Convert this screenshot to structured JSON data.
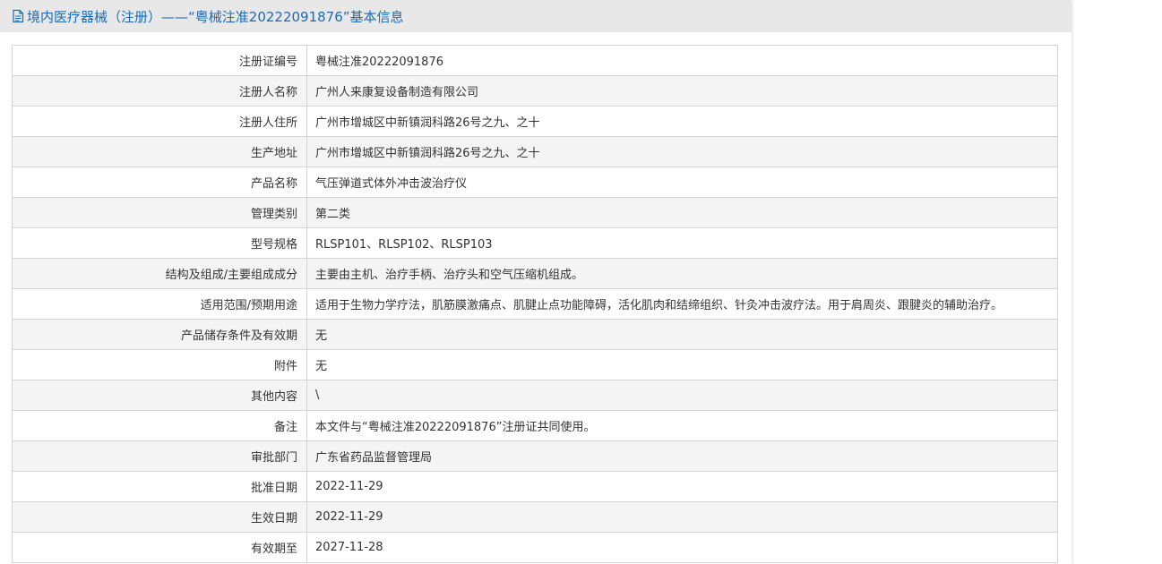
{
  "header": {
    "title": "境内医疗器械（注册）——“粤械注准20222091876”基本信息",
    "icon": "document-icon",
    "color": "#1a6bb5"
  },
  "table": {
    "rows": [
      {
        "label": "注册证编号",
        "value": "粤械注准20222091876"
      },
      {
        "label": "注册人名称",
        "value": "广州人来康复设备制造有限公司"
      },
      {
        "label": "注册人住所",
        "value": "广州市增城区中新镇润科路26号之九、之十"
      },
      {
        "label": "生产地址",
        "value": "广州市增城区中新镇润科路26号之九、之十"
      },
      {
        "label": "产品名称",
        "value": "气压弹道式体外冲击波治疗仪"
      },
      {
        "label": "管理类别",
        "value": "第二类"
      },
      {
        "label": "型号规格",
        "value": "RLSP101、RLSP102、RLSP103"
      },
      {
        "label": "结构及组成/主要组成成分",
        "value": "主要由主机、治疗手柄、治疗头和空气压缩机组成。"
      },
      {
        "label": "适用范围/预期用途",
        "value": "适用于生物力学疗法，肌筋膜激痛点、肌腱止点功能障碍，活化肌肉和结缔组织、针灸冲击波疗法。用于肩周炎、跟腱炎的辅助治疗。"
      },
      {
        "label": "产品储存条件及有效期",
        "value": "无"
      },
      {
        "label": "附件",
        "value": "无"
      },
      {
        "label": "其他内容",
        "value": "\\"
      },
      {
        "label": "备注",
        "value": "本文件与“粤械注准20222091876”注册证共同使用。"
      },
      {
        "label": "审批部门",
        "value": "广东省药品监督管理局"
      },
      {
        "label": "批准日期",
        "value": "2022-11-29"
      },
      {
        "label": "生效日期",
        "value": "2022-11-29"
      },
      {
        "label": "有效期至",
        "value": "2027-11-28"
      }
    ]
  }
}
